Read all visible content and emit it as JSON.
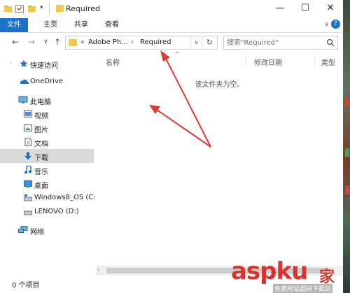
{
  "window": {
    "title": "Required",
    "controls": {
      "minimize": "—",
      "maximize": "☐",
      "close": "✕"
    }
  },
  "ribbon": {
    "tabs": [
      {
        "label": "文件",
        "active": true
      },
      {
        "label": "主页"
      },
      {
        "label": "共享"
      },
      {
        "label": "查看"
      }
    ],
    "help": "?"
  },
  "navigation": {
    "back": "←",
    "forward": "→",
    "recent": "∨",
    "up": "↑"
  },
  "address": {
    "overflow": "«",
    "segments": [
      "Adobe Ph...",
      "Required"
    ],
    "separator": "›",
    "refresh": "↻"
  },
  "search": {
    "placeholder": "搜索\"Required\""
  },
  "sidebar": {
    "items": [
      {
        "label": "快速访问",
        "icon": "star-icon"
      },
      {
        "label": "OneDrive",
        "icon": "cloud-icon"
      },
      {
        "label": "此电脑",
        "icon": "computer-icon"
      },
      {
        "label": "视频",
        "icon": "video-icon"
      },
      {
        "label": "图片",
        "icon": "picture-icon"
      },
      {
        "label": "文档",
        "icon": "document-icon"
      },
      {
        "label": "下载",
        "icon": "download-icon",
        "selected": true
      },
      {
        "label": "音乐",
        "icon": "music-icon"
      },
      {
        "label": "桌面",
        "icon": "desktop-icon"
      },
      {
        "label": "Windows8_OS (C:)",
        "icon": "drive-icon"
      },
      {
        "label": "LENOVO (D:)",
        "icon": "drive-icon"
      },
      {
        "label": "网络",
        "icon": "network-icon"
      }
    ]
  },
  "columns": [
    "名称",
    "修改日期",
    "类型"
  ],
  "empty_message": "该文件夹为空。",
  "status": {
    "item_count": "0 个项目"
  },
  "colors": {
    "accent": "#1a73c8",
    "arrow": "#e03a32",
    "folder": "#f2c94c"
  },
  "watermark": {
    "brand": "aspku",
    "brand_cn": "家",
    "tagline": "免费网站源码下载站"
  }
}
